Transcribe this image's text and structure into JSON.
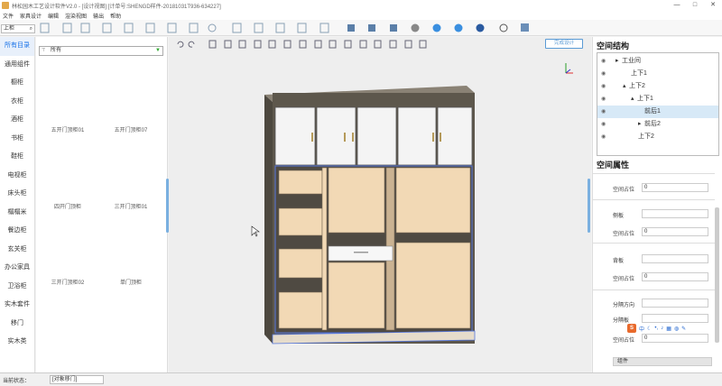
{
  "window": {
    "title": "林松园木工艺设计软件V2.0 - [设计视图] [计单号:SHENGD样件-20181031T936-634227]",
    "min_label": "—",
    "max_label": "□",
    "close_label": "✕"
  },
  "menu": [
    "文件",
    "家具设计",
    "编辑",
    "渲染视图",
    "输出",
    "帮助"
  ],
  "search": {
    "value": "上柜",
    "icon": "search-icon"
  },
  "left_nav": {
    "items": [
      "所有目录",
      "通用组件",
      "橱柜",
      "衣柜",
      "酒柜",
      "书柜",
      "鞋柜",
      "电视柜",
      "床头柜",
      "榻榻米",
      "餐边柜",
      "玄关柜",
      "办公家具",
      "卫浴柜",
      "实木套件",
      "移门",
      "实木类"
    ],
    "active_index": 0
  },
  "catalog": {
    "filter_value": "所有",
    "items": [
      "五开门顶柜01",
      "五开门顶柜07",
      "四开门顶柜",
      "三开门顶柜01",
      "三开门顶柜02",
      "单门顶柜"
    ]
  },
  "viewport": {
    "design_button": "完成设计"
  },
  "structure": {
    "title": "空间结构",
    "rows": [
      {
        "label": "工业间",
        "indent": 1,
        "arrow": "▸"
      },
      {
        "label": "上下1",
        "indent": 2,
        "arrow": ""
      },
      {
        "label": "上下2",
        "indent": 2,
        "arrow": "▴"
      },
      {
        "label": "上下1",
        "indent": 3,
        "arrow": "▴"
      },
      {
        "label": "前后1",
        "indent": 4,
        "arrow": "",
        "selected": true
      },
      {
        "label": "前后2",
        "indent": 4,
        "arrow": "▸"
      },
      {
        "label": "上下2",
        "indent": 3,
        "arrow": ""
      }
    ]
  },
  "properties": {
    "title": "空间属性",
    "rows": [
      {
        "label": "空间占位",
        "value": "0"
      },
      {
        "label": "侧板",
        "value": ""
      },
      {
        "label": "空间占位",
        "value": "0"
      },
      {
        "label": "背板",
        "value": ""
      },
      {
        "label": "空间占位",
        "value": "0"
      },
      {
        "label": "分隔方向",
        "value": ""
      },
      {
        "label": "分隔板",
        "value": ""
      },
      {
        "label": "空间占位",
        "value": "0"
      }
    ],
    "bottom_label": "组件"
  },
  "status": {
    "label": "当前状态：",
    "value": "[对象移门]"
  },
  "ime": {
    "letter": "S",
    "zh": "中"
  },
  "colors": {
    "accent": "#1a73e8",
    "wood": "#f2d9b5",
    "carcass": "#5d574c",
    "door": "#f4f4f4"
  }
}
